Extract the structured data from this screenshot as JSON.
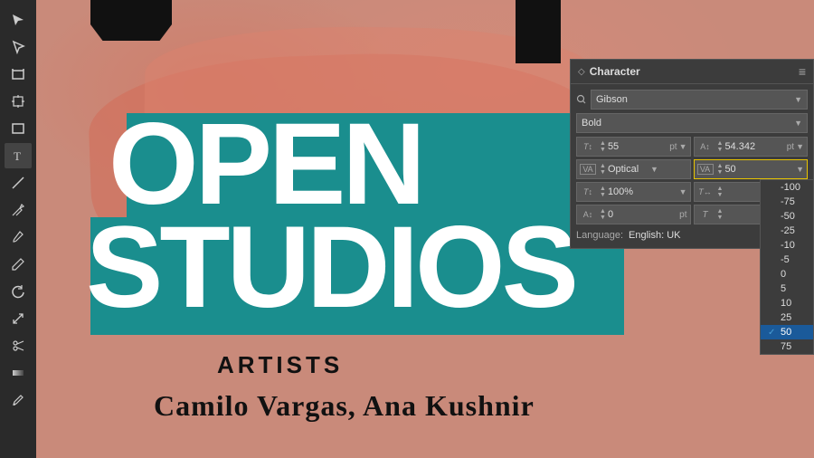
{
  "toolbar": {
    "tools": [
      {
        "name": "arrow-tool",
        "symbol": "↖",
        "active": false
      },
      {
        "name": "direct-select-tool",
        "symbol": "↗",
        "active": false
      },
      {
        "name": "artboard-tool",
        "symbol": "⬚",
        "active": false
      },
      {
        "name": "move-tool",
        "symbol": "⤢",
        "active": false
      },
      {
        "name": "rectangle-tool",
        "symbol": "▭",
        "active": false
      },
      {
        "name": "type-tool",
        "symbol": "T",
        "active": true
      },
      {
        "name": "line-tool",
        "symbol": "/",
        "active": false
      },
      {
        "name": "pen-tool",
        "symbol": "✒",
        "active": false
      },
      {
        "name": "paintbrush-tool",
        "symbol": "✏",
        "active": false
      },
      {
        "name": "pencil-tool",
        "symbol": "✐",
        "active": false
      },
      {
        "name": "rotate-tool",
        "symbol": "↻",
        "active": false
      },
      {
        "name": "scale-tool",
        "symbol": "⤡",
        "active": false
      },
      {
        "name": "scissors-tool",
        "symbol": "✂",
        "active": false
      },
      {
        "name": "gradient-tool",
        "symbol": "◫",
        "active": false
      },
      {
        "name": "eyedropper-tool",
        "symbol": "⊘",
        "active": false
      }
    ]
  },
  "canvas": {
    "main_title_line1": "OPEN",
    "main_title_line2": "STUDIOS",
    "sub_title": "ARTISTS",
    "names": "Camilo Vargas, Ana Kushnir"
  },
  "character_panel": {
    "title": "Character",
    "diamond_symbol": "◇",
    "font_family": "Gibson",
    "font_style": "Bold",
    "font_size": {
      "label": "T↕",
      "value": "55",
      "unit": "pt"
    },
    "leading": {
      "value": "54.342",
      "unit": "pt"
    },
    "kerning": {
      "label": "VA",
      "value": "Optical"
    },
    "tracking": {
      "label": "VA",
      "value": "50"
    },
    "scale_vertical": {
      "label": "T↕",
      "value": "100",
      "unit": "%"
    },
    "scale_horizontal": {
      "label": "T↔",
      "value": ""
    },
    "baseline_shift": {
      "label": "A↕",
      "value": "0",
      "unit": "pt"
    },
    "rotate": {
      "label": "T↺",
      "value": ""
    },
    "language_label": "Language:",
    "language_value": "English: UK",
    "tracking_dropdown": {
      "items": [
        {
          "value": "-100",
          "selected": false,
          "active": false
        },
        {
          "value": "-75",
          "selected": false,
          "active": false
        },
        {
          "value": "-50",
          "selected": false,
          "active": false
        },
        {
          "value": "-25",
          "selected": false,
          "active": false
        },
        {
          "value": "-10",
          "selected": false,
          "active": false
        },
        {
          "value": "-5",
          "selected": false,
          "active": false
        },
        {
          "value": "0",
          "selected": false,
          "active": false
        },
        {
          "value": "5",
          "selected": false,
          "active": false
        },
        {
          "value": "10",
          "selected": false,
          "active": false
        },
        {
          "value": "25",
          "selected": false,
          "active": false
        },
        {
          "value": "50",
          "selected": true,
          "active": true
        },
        {
          "value": "75",
          "selected": false,
          "active": false
        }
      ]
    }
  }
}
